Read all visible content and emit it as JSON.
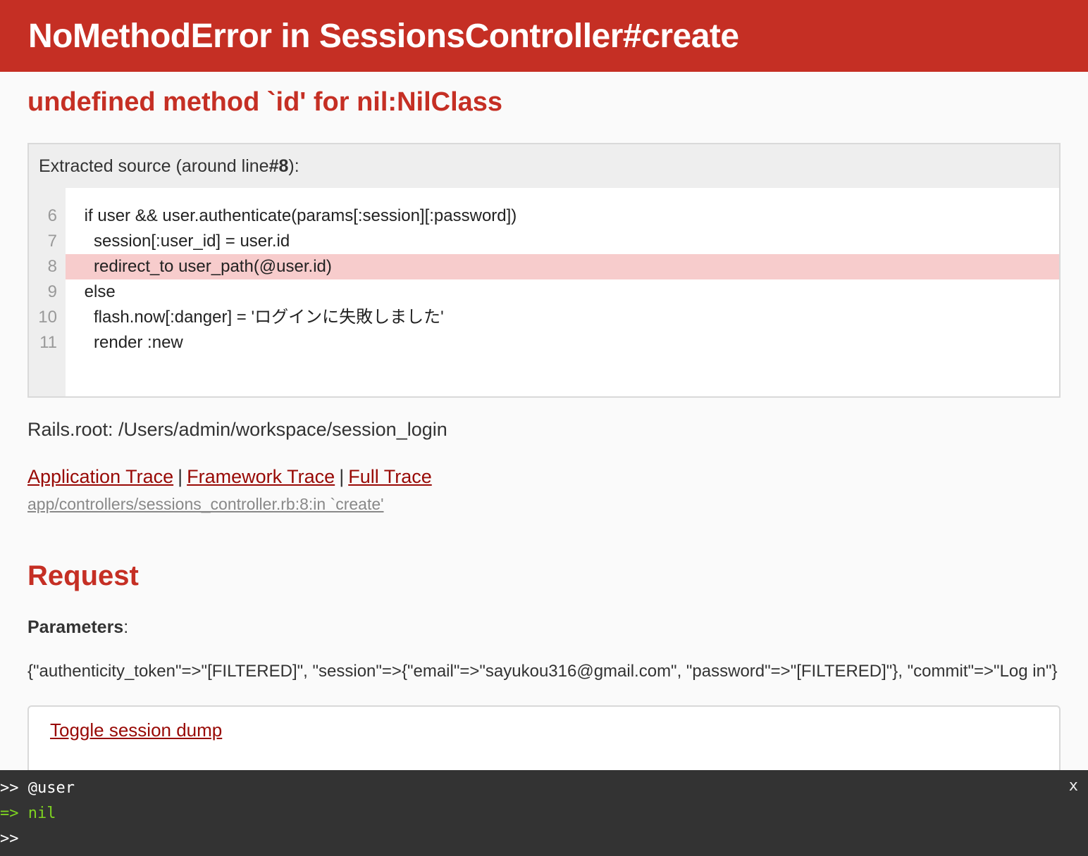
{
  "header": {
    "title": "NoMethodError in SessionsController#create"
  },
  "error": {
    "message": "undefined method `id' for nil:NilClass"
  },
  "source": {
    "info_prefix": "Extracted source (around line ",
    "info_line": "#8",
    "info_suffix": "):",
    "lines": [
      {
        "num": "6",
        "code": "    if user && user.authenticate(params[:session][:password])"
      },
      {
        "num": "7",
        "code": "      session[:user_id] = user.id"
      },
      {
        "num": "8",
        "code": "      redirect_to user_path(@user.id)"
      },
      {
        "num": "9",
        "code": "    else"
      },
      {
        "num": "10",
        "code": "      flash.now[:danger] = 'ログインに失敗しました'"
      },
      {
        "num": "11",
        "code": "      render :new"
      }
    ],
    "highlight_line": "8"
  },
  "rails_root": "Rails.root: /Users/admin/workspace/session_login",
  "traces": {
    "application": "Application Trace",
    "framework": "Framework Trace",
    "full": "Full Trace",
    "separator": "|",
    "line": "app/controllers/sessions_controller.rb:8:in `create'"
  },
  "request": {
    "title": "Request",
    "params_label": "Parameters",
    "params_colon": ":",
    "params_value": "{\"authenticity_token\"=>\"[FILTERED]\", \"session\"=>{\"email\"=>\"sayukou316@gmail.com\", \"password\"=>\"[FILTERED]\"}, \"commit\"=>\"Log in\"}",
    "toggle_session": "Toggle session dump"
  },
  "console": {
    "input": ">> @user",
    "result": "=> nil",
    "prompt": ">>",
    "close": "x"
  }
}
